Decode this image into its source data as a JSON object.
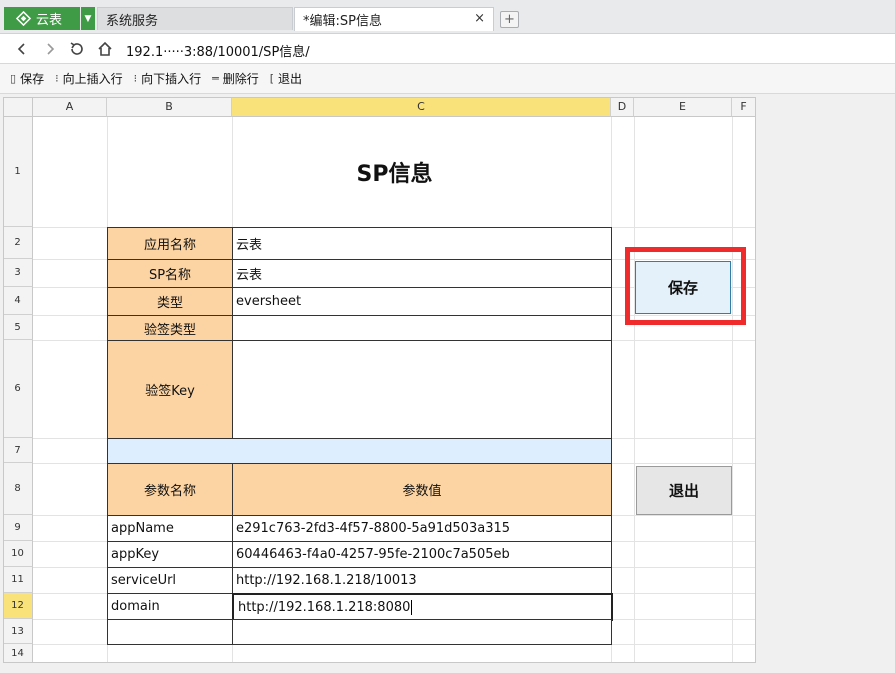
{
  "tabs": {
    "app_name": "云表",
    "system_tab": "系统服务",
    "edit_tab": "*编辑:SP信息",
    "close_symbol": "×",
    "new_tab_symbol": "+"
  },
  "address": {
    "url": "192.1·····3:88/10001/SP信息/"
  },
  "toolbar": {
    "save_label": "保存",
    "insert_above_label": "向上插入行",
    "insert_below_label": "向下插入行",
    "delete_row_label": "删除行",
    "exit_label": "退出"
  },
  "sheet": {
    "columns": [
      "A",
      "B",
      "C",
      "D",
      "E",
      "F"
    ],
    "rows": [
      "1",
      "2",
      "3",
      "4",
      "5",
      "6",
      "7",
      "8",
      "9",
      "10",
      "11",
      "12",
      "13",
      "14"
    ],
    "title": "SP信息",
    "fields": [
      {
        "label": "应用名称",
        "value": "云表"
      },
      {
        "label": "SP名称",
        "value": "云表"
      },
      {
        "label": "类型",
        "value": "eversheet"
      },
      {
        "label": "验签类型",
        "value": ""
      },
      {
        "label": "验签Key",
        "value": ""
      }
    ],
    "param_header_name": "参数名称",
    "param_header_value": "参数值",
    "params": [
      {
        "name": "appName",
        "value": "e291c763-2fd3-4f57-8800-5a91d503a315"
      },
      {
        "name": "appKey",
        "value": "60446463-f4a0-4257-95fe-2100c7a505eb"
      },
      {
        "name": "serviceUrl",
        "value": "http://192.168.1.218/10013"
      },
      {
        "name": "domain",
        "value": "http://192.168.1.218:8080"
      },
      {
        "name": "",
        "value": ""
      }
    ],
    "save_button": "保存",
    "exit_button": "退出"
  },
  "colors": {
    "brand_green": "#3f9b45",
    "label_fill": "#fcd4a3",
    "separator_fill": "#ddeeff",
    "selected_header": "#f9e27a",
    "highlight_red": "#ef2b2b"
  }
}
